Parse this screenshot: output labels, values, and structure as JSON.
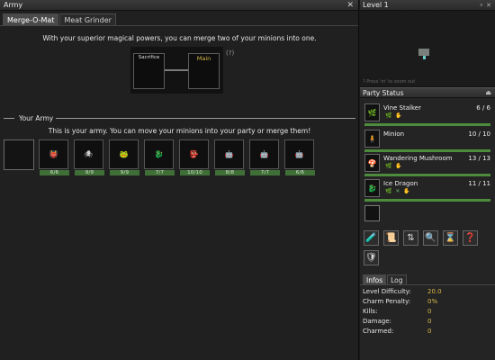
{
  "left": {
    "title": "Army",
    "tabs": [
      "Merge-O-Mat",
      "Meat Grinder"
    ],
    "merge": {
      "info": "With your superior magical powers, you can merge two of your minions into one.",
      "sacrifice_label": "Sacrifice",
      "main_label": "Main",
      "help": "(?)"
    },
    "army": {
      "section_title": "Your Army",
      "info": "This is your army. You can move your minions into your party or merge them!",
      "units": [
        {
          "life": "",
          "icon": ""
        },
        {
          "life": "6/6",
          "icon": "👹"
        },
        {
          "life": "9/9",
          "icon": "🕷"
        },
        {
          "life": "9/9",
          "icon": "🐸"
        },
        {
          "life": "7/7",
          "icon": "🐉"
        },
        {
          "life": "10/10",
          "icon": "👺"
        },
        {
          "life": "8/8",
          "icon": "🤖"
        },
        {
          "life": "7/7",
          "icon": "🤖"
        },
        {
          "life": "6/6",
          "icon": "🤖"
        }
      ]
    }
  },
  "right": {
    "title": "Level 1",
    "minimap_hint": "? Press 'm' to zoom out",
    "party_title": "Party Status",
    "members": [
      {
        "name": "Vine Stalker",
        "hp": "6 / 6",
        "skills": "🌿 ✋",
        "icon": "🌿"
      },
      {
        "name": "Minion",
        "hp": "10 / 10",
        "skills": "",
        "icon": "🧍"
      },
      {
        "name": "Wandering Mushroom",
        "hp": "13 / 13",
        "skills": "🌿 ✋",
        "icon": "🍄"
      },
      {
        "name": "Ice Dragon",
        "hp": "11 / 11",
        "skills": "🌿 ✕ ✋",
        "icon": "🐉"
      }
    ],
    "actions": [
      "🧪",
      "📜",
      "⇅",
      "🔍",
      "⌛",
      "❓",
      "🛡"
    ],
    "info_tabs": [
      "Infos",
      "Log"
    ],
    "stats": [
      {
        "label": "Level Difficulty:",
        "value": "20.0"
      },
      {
        "label": "Charm Penalty:",
        "value": "0%"
      },
      {
        "label": "Kills:",
        "value": "0"
      },
      {
        "label": "Damage:",
        "value": "0"
      },
      {
        "label": "Charmed:",
        "value": "0"
      }
    ]
  },
  "colors": {
    "gold": "#d9b94a",
    "life_bar": "#3f6f36",
    "party_bar": "#4d8c3d"
  }
}
